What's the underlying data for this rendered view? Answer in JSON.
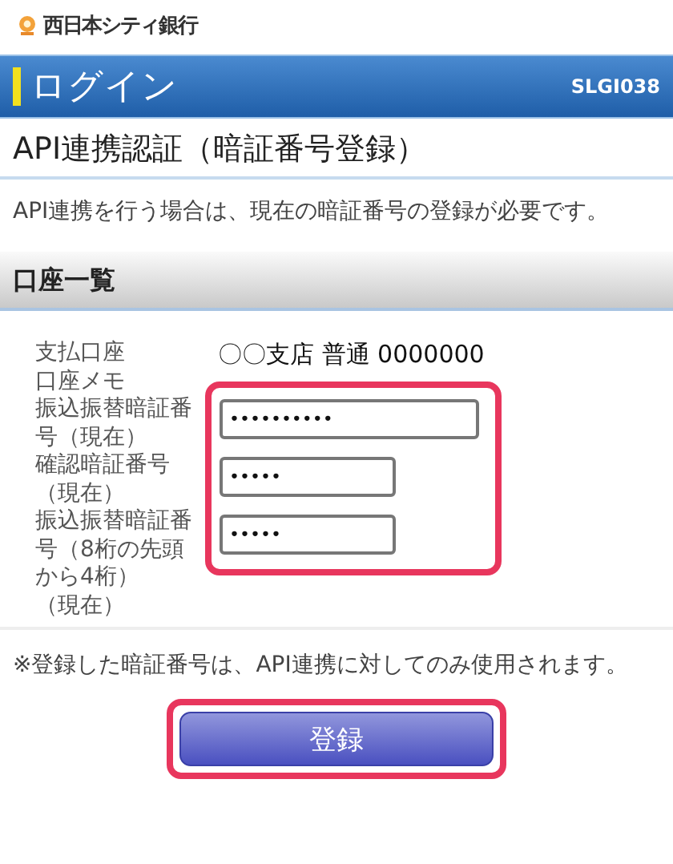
{
  "bank_name": "西日本シティ銀行",
  "header": {
    "title": "ログイン",
    "screen_id": "SLGI038"
  },
  "page_title": "API連携認証（暗証番号登録）",
  "intro": "API連携を行う場合は、現在の暗証番号の登録が必要です。",
  "section": {
    "title": "口座一覧"
  },
  "account": [
    {
      "label": "支払口座",
      "value": "〇〇支店 普通 0000000"
    },
    {
      "label": "口座メモ"
    }
  ],
  "pin_fields": {
    "highlighted": true,
    "fields": [
      {
        "label": "振込振替暗証番号（現在）",
        "value": "••••••••••"
      },
      {
        "label": "確認暗証番号",
        "label_suffix": "（現在）",
        "value": "•••••"
      },
      {
        "label": "振込振替暗証番号（8桁の先頭から4桁）",
        "label_suffix": "（現在）",
        "value": "•••••"
      }
    ]
  },
  "note": "※登録した暗証番号は、API連携に対してのみ使用されます。",
  "submit": {
    "label": "登録",
    "highlighted": true
  }
}
